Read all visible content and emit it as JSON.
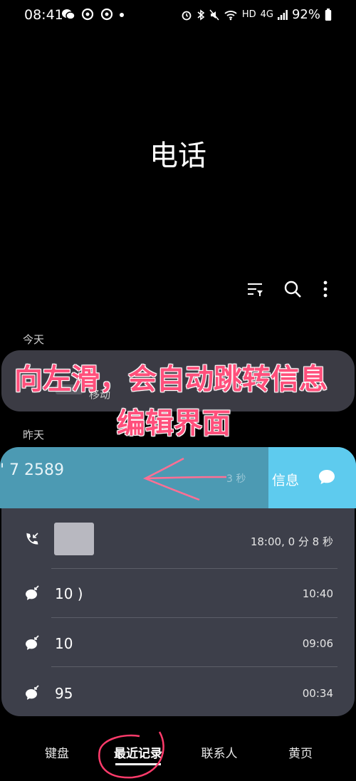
{
  "status_bar": {
    "time": "08:41",
    "hd_label": "HD",
    "network_label": "4G",
    "battery": "92%"
  },
  "title": "电话",
  "sections": {
    "today": "今天",
    "yesterday": "昨天"
  },
  "today_call": {
    "subtitle": "移动"
  },
  "overlay": {
    "line1": "向左滑，会自动跳转信息",
    "line2": "编辑界面"
  },
  "swiped_call": {
    "number": "' 7 2589",
    "duration": "3 秒",
    "action_label": "信息"
  },
  "calls": [
    {
      "number": "",
      "time": "18:00, 0 分 8 秒",
      "type": "incoming-call"
    },
    {
      "number": "10                    )",
      "time": "10:40",
      "type": "message-call"
    },
    {
      "number": "10",
      "time": "09:06",
      "type": "message-call"
    },
    {
      "number": "95",
      "time": "00:34",
      "type": "message-call"
    }
  ],
  "nav": {
    "keypad": "键盘",
    "recents": "最近记录",
    "contacts": "联系人",
    "yellow_pages": "黄页"
  },
  "colors": {
    "swipe_row": "#4c9ab3",
    "swipe_action": "#5ecbee",
    "card": "#3d3f4a",
    "overlay_text": "#ff4f7b"
  }
}
